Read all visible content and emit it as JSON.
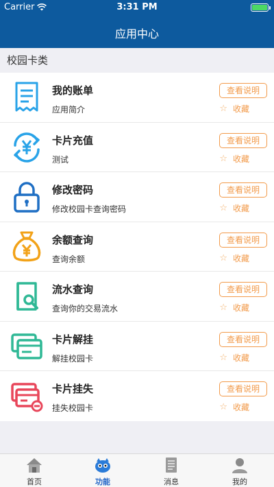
{
  "status": {
    "carrier": "Carrier",
    "time": "3:31 PM"
  },
  "nav": {
    "title": "应用中心"
  },
  "section": {
    "title": "校园卡类"
  },
  "items": [
    {
      "title": "我的账单",
      "desc": "应用简介",
      "button": "查看说明",
      "fav": "收藏",
      "icon": "bill-icon",
      "color": "#29a3e8"
    },
    {
      "title": "卡片充值",
      "desc": "测试",
      "button": "查看说明",
      "fav": "收藏",
      "icon": "recharge-icon",
      "color": "#29a3e8"
    },
    {
      "title": "修改密码",
      "desc": "修改校园卡查询密码",
      "button": "查看说明",
      "fav": "收藏",
      "icon": "lock-icon",
      "color": "#1f6fc4"
    },
    {
      "title": "余额查询",
      "desc": "查询余额",
      "button": "查看说明",
      "fav": "收藏",
      "icon": "money-bag-icon",
      "color": "#f2a218"
    },
    {
      "title": "流水查询",
      "desc": "查询你的交易流水",
      "button": "查看说明",
      "fav": "收藏",
      "icon": "search-doc-icon",
      "color": "#2fb895"
    },
    {
      "title": "卡片解挂",
      "desc": "解挂校园卡",
      "button": "查看说明",
      "fav": "收藏",
      "icon": "card-unlock-icon",
      "color": "#2fb895"
    },
    {
      "title": "卡片挂失",
      "desc": "挂失校园卡",
      "button": "查看说明",
      "fav": "收藏",
      "icon": "card-lost-icon",
      "color": "#e8465a"
    }
  ],
  "tabs": [
    {
      "label": "首页",
      "icon": "home-icon",
      "active": false
    },
    {
      "label": "功能",
      "icon": "function-icon",
      "active": true
    },
    {
      "label": "消息",
      "icon": "message-icon",
      "active": false
    },
    {
      "label": "我的",
      "icon": "profile-icon",
      "active": false
    }
  ]
}
